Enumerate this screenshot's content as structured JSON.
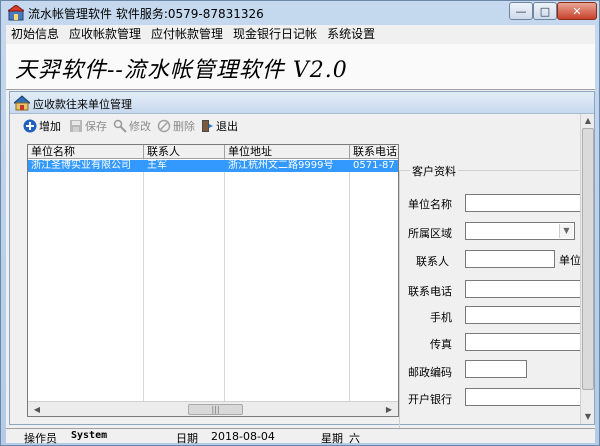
{
  "window": {
    "title": "流水帐管理软件  软件服务:0579-87831326",
    "controls": {
      "minimize": "—",
      "maximize": "□",
      "close": "✕"
    }
  },
  "menu": [
    "初始信息",
    "应收帐款管理",
    "应付帐款管理",
    "现金银行日记帐",
    "系统设置"
  ],
  "banner": {
    "title": "天羿软件--流水帐管理软件  V2.0"
  },
  "child_window": {
    "title": "应收款往来单位管理"
  },
  "toolbar": [
    {
      "label": "增加",
      "icon": "add-icon",
      "enabled": true
    },
    {
      "label": "保存",
      "icon": "save-icon",
      "enabled": false
    },
    {
      "label": "修改",
      "icon": "edit-icon",
      "enabled": false
    },
    {
      "label": "删除",
      "icon": "delete-icon",
      "enabled": false
    },
    {
      "label": "退出",
      "icon": "exit-icon",
      "enabled": true
    }
  ],
  "grid": {
    "columns": [
      "单位名称",
      "联系人",
      "单位地址",
      "联系电话"
    ],
    "rows": [
      [
        "浙江圣博实业有限公司",
        "王军",
        "浙江杭州文二路9999号",
        "0571-87"
      ]
    ],
    "scroll_thumb": "|||"
  },
  "customer_panel": {
    "title": "客户资料",
    "fields": {
      "unit_name": "单位名称",
      "region": "所属区域",
      "contact": "联系人",
      "unit_cut": "单位:",
      "phone": "联系电话",
      "mobile": "手机",
      "fax": "传真",
      "postal": "邮政编码",
      "bank": "开户银行"
    }
  },
  "status": {
    "operator_label": "操作员",
    "operator": "System",
    "date_label": "日期",
    "date": "2018-08-04",
    "weekday_label": "星期",
    "weekday": "六"
  },
  "colors": {
    "selection": "#3399ff",
    "titlebar": "#c5d8ee"
  }
}
